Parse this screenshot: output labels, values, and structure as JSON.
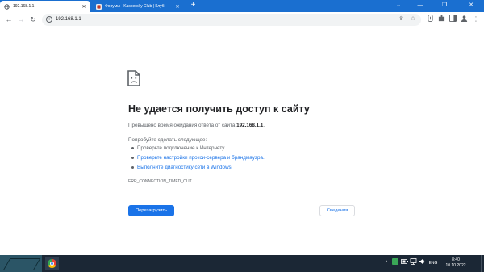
{
  "tabs": [
    {
      "title": "192.168.1.1",
      "active": true,
      "favicon": "globe-icon"
    },
    {
      "title": "Форумы - Kaspersky Club | Клуб",
      "active": false,
      "favicon": "kaspersky-icon"
    }
  ],
  "new_tab_label": "+",
  "window_controls": {
    "tab_list": "⌄",
    "minimize": "—",
    "restore": "❐",
    "close": "✕"
  },
  "toolbar": {
    "back": "←",
    "forward": "→",
    "reload": "↻",
    "url": "192.168.1.1",
    "icons": [
      "share-icon",
      "star-icon",
      "extension-icon",
      "puzzle-icon",
      "sidebar-icon",
      "profile-icon",
      "menu-icon"
    ]
  },
  "error_page": {
    "heading": "Не удается получить доступ к сайту",
    "subtitle_prefix": "Превышено время ожидания ответа от сайта ",
    "subtitle_host": "192.168.1.1",
    "subtitle_suffix": ".",
    "try_label": "Попробуйте сделать следующее:",
    "suggestions": [
      {
        "text": "Проверьте подключение к Интернету.",
        "link": false
      },
      {
        "text": "Проверьте настройки прокси-сервера и брандмауэра.",
        "link": true
      },
      {
        "text": "Выполните диагностику сети в Windows",
        "link": true
      }
    ],
    "error_code": "ERR_CONNECTION_TIMED_OUT",
    "reload_button": "Перезагрузить",
    "details_button": "Сведения"
  },
  "taskbar": {
    "language": "ENG",
    "time": "8:40",
    "date": "10.10.2022",
    "tray_icons": [
      "chevron-up-icon",
      "app-icon",
      "battery-icon",
      "network-icon",
      "volume-icon"
    ]
  },
  "colors": {
    "tabstrip": "#1a6fd0",
    "accent": "#1a73e8",
    "taskbar": "#1b2735"
  }
}
